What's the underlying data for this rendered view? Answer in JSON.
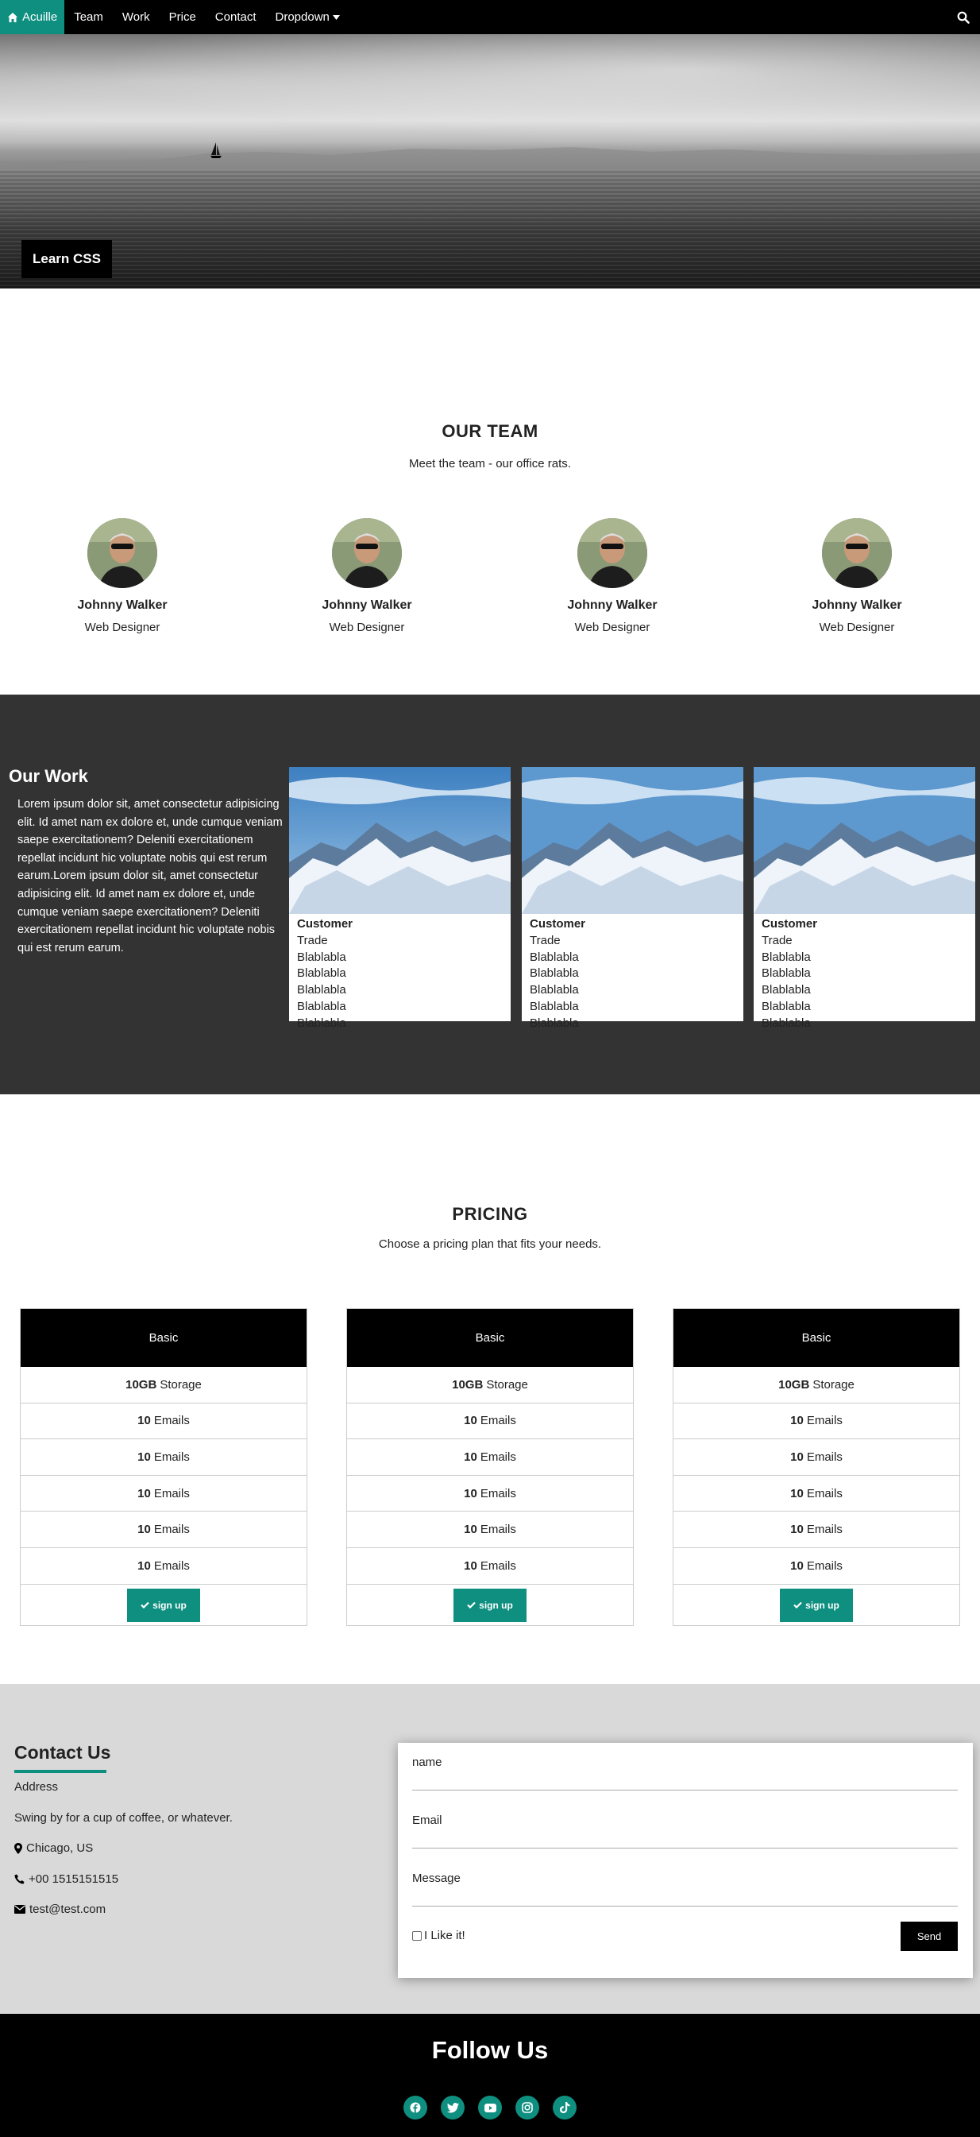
{
  "nav": {
    "brand": "Acuille",
    "items": [
      "Team",
      "Work",
      "Price",
      "Contact"
    ],
    "dropdown": "Dropdown"
  },
  "hero": {
    "label": "Learn CSS"
  },
  "team": {
    "title": "OUR TEAM",
    "subtitle": "Meet the team - our office rats.",
    "members": [
      {
        "name": "Johnny Walker",
        "role": "Web Designer"
      },
      {
        "name": "Johnny Walker",
        "role": "Web Designer"
      },
      {
        "name": "Johnny Walker",
        "role": "Web Designer"
      },
      {
        "name": "Johnny Walker",
        "role": "Web Designer"
      }
    ]
  },
  "work": {
    "title": "Our Work",
    "text": "Lorem ipsum dolor sit, amet consectetur adipisicing elit. Id amet nam ex dolore et, unde cumque veniam saepe exercitationem? Deleniti exercitationem repellat incidunt hic voluptate nobis qui est rerum earum.Lorem ipsum dolor sit, amet consectetur adipisicing elit. Id amet nam ex dolore et, unde cumque veniam saepe exercitationem? Deleniti exercitationem repellat incidunt hic voluptate nobis qui est rerum earum.",
    "cards": [
      {
        "title": "Customer",
        "lines": [
          "Trade",
          "Blablabla",
          "Blablabla",
          "Blablabla",
          "Blablabla",
          "Blablabla"
        ]
      },
      {
        "title": "Customer",
        "lines": [
          "Trade",
          "Blablabla",
          "Blablabla",
          "Blablabla",
          "Blablabla",
          "Blablabla"
        ]
      },
      {
        "title": "Customer",
        "lines": [
          "Trade",
          "Blablabla",
          "Blablabla",
          "Blablabla",
          "Blablabla",
          "Blablabla"
        ]
      }
    ]
  },
  "pricing": {
    "title": "PRICING",
    "subtitle": "Choose a pricing plan that fits your needs.",
    "plans": [
      {
        "name": "Basic",
        "rows": [
          {
            "bold": "10GB",
            "text": "Storage"
          },
          {
            "bold": "10",
            "text": "Emails"
          },
          {
            "bold": "10",
            "text": "Emails"
          },
          {
            "bold": "10",
            "text": "Emails"
          },
          {
            "bold": "10",
            "text": "Emails"
          },
          {
            "bold": "10",
            "text": "Emails"
          }
        ],
        "button": "sign up"
      },
      {
        "name": "Basic",
        "rows": [
          {
            "bold": "10GB",
            "text": "Storage"
          },
          {
            "bold": "10",
            "text": "Emails"
          },
          {
            "bold": "10",
            "text": "Emails"
          },
          {
            "bold": "10",
            "text": "Emails"
          },
          {
            "bold": "10",
            "text": "Emails"
          },
          {
            "bold": "10",
            "text": "Emails"
          }
        ],
        "button": "sign up"
      },
      {
        "name": "Basic",
        "rows": [
          {
            "bold": "10GB",
            "text": "Storage"
          },
          {
            "bold": "10",
            "text": "Emails"
          },
          {
            "bold": "10",
            "text": "Emails"
          },
          {
            "bold": "10",
            "text": "Emails"
          },
          {
            "bold": "10",
            "text": "Emails"
          },
          {
            "bold": "10",
            "text": "Emails"
          }
        ],
        "button": "sign up"
      }
    ]
  },
  "contact": {
    "title": "Contact Us",
    "address_label": "Address",
    "tagline": "Swing by for a cup of coffee, or whatever.",
    "location": "Chicago, US",
    "phone": "+00 1515151515",
    "email": "test@test.com",
    "form": {
      "name_label": "name",
      "email_label": "Email",
      "message_label": "Message",
      "checkbox_label": "I Like it!",
      "send": "Send"
    }
  },
  "footer": {
    "title": "Follow Us",
    "icons": [
      "facebook-icon",
      "twitter-icon",
      "youtube-icon",
      "instagram-icon",
      "tiktok-icon"
    ]
  },
  "colors": {
    "accent": "#0e8f80",
    "dark": "#333333",
    "black": "#000000",
    "contact_bg": "#d9d9d9"
  }
}
